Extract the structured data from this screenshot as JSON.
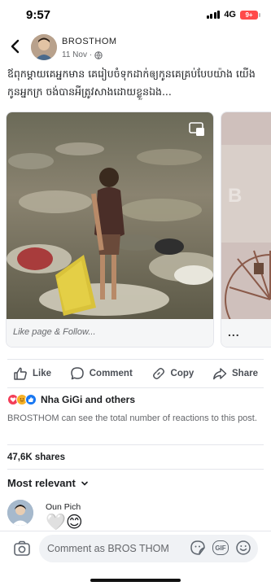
{
  "status_bar": {
    "time": "9:57",
    "network": "4G",
    "battery": "9+"
  },
  "post": {
    "author": "BROSTHOM",
    "date": "11 Nov ·",
    "text": "ឪពុកម្ដាយគេអ្នកមាន គេរៀបចំទុកដាក់ឲ្យកូនគេគ្រប់បែបយ៉ាង យើងកូនអ្នកក្រ ចង់បានអីត្រូវសាងដោយខ្លួនឯង...",
    "carousel": {
      "card_footer": "Like page & Follow...",
      "second_card_more": "..."
    }
  },
  "actions": {
    "like": "Like",
    "comment": "Comment",
    "copy": "Copy",
    "share": "Share"
  },
  "reactions": {
    "summary": "Nha GiGi and others",
    "note": "BROSTHOM can see the total number of reactions to this post."
  },
  "shares": "47,6K shares",
  "sort_label": "Most relevant",
  "comments": [
    {
      "author": "Oun Pich",
      "content": "🤍😊"
    }
  ],
  "composer": {
    "placeholder": "Comment as BROS THOM",
    "gif_label": "GIF"
  },
  "icons": {
    "back": "chevron-left-icon",
    "globe": "globe-icon",
    "like": "thumbs-up-icon",
    "comment": "speech-bubble-icon",
    "copy": "link-icon",
    "share": "share-arrow-icon",
    "camera": "camera-icon",
    "sticker": "sticker-icon",
    "emoji": "smiley-icon"
  },
  "colors": {
    "accent": "#1877f2",
    "text": "#1c1e21",
    "muted": "#65676b",
    "battery": "#ff4a4a"
  }
}
